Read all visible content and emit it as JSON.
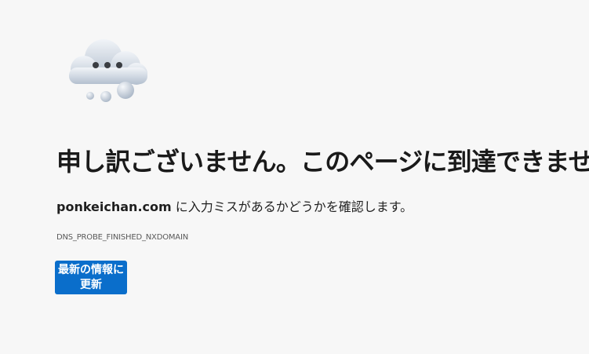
{
  "error": {
    "icon": "cloud-dots-icon",
    "title": "申し訳ございません。このページに到達できません",
    "domain": "ponkeichan.com",
    "message_suffix": " に入力ミスがあるかどうかを確認します。",
    "code": "DNS_PROBE_FINISHED_NXDOMAIN",
    "refresh_label": "最新の情報に更新"
  },
  "colors": {
    "background": "#f7f7f7",
    "button": "#0a6ecb",
    "button_text": "#ffffff",
    "cloud": "#c9d2de"
  }
}
